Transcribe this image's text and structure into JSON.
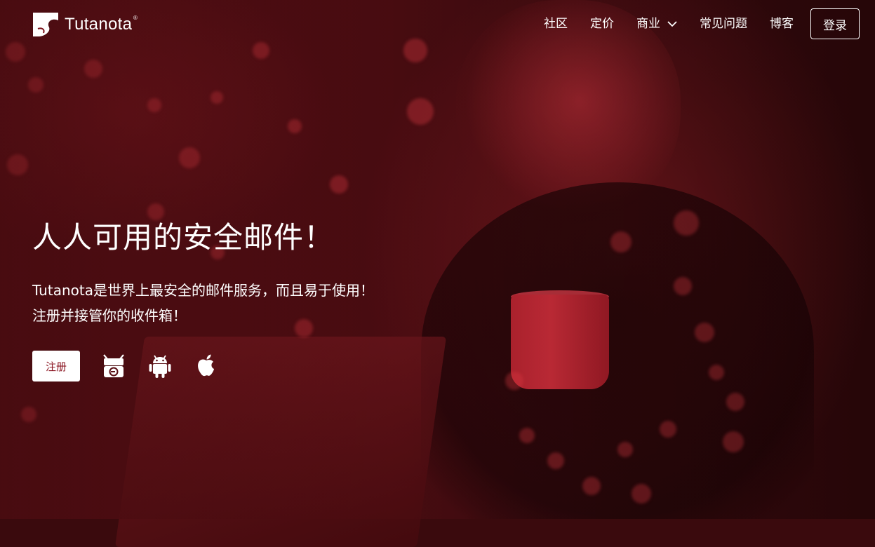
{
  "header": {
    "logo_text": "Tutanota",
    "logo_reg": "®",
    "nav": [
      {
        "label": "社区"
      },
      {
        "label": "定价"
      },
      {
        "label": "商业"
      },
      {
        "label": "常见问题"
      },
      {
        "label": "博客"
      }
    ],
    "login_label": "登录"
  },
  "hero": {
    "title": "人人可用的安全邮件！",
    "subtitle": "Tutanota是世界上最安全的邮件服务，而且易于使用！注册并接管你的收件箱！",
    "signup_label": "注册",
    "app_icons": [
      "f-droid-icon",
      "android-icon",
      "apple-icon"
    ]
  },
  "colors": {
    "accent": "#8a1420",
    "hero_tint": "#5a1016"
  }
}
